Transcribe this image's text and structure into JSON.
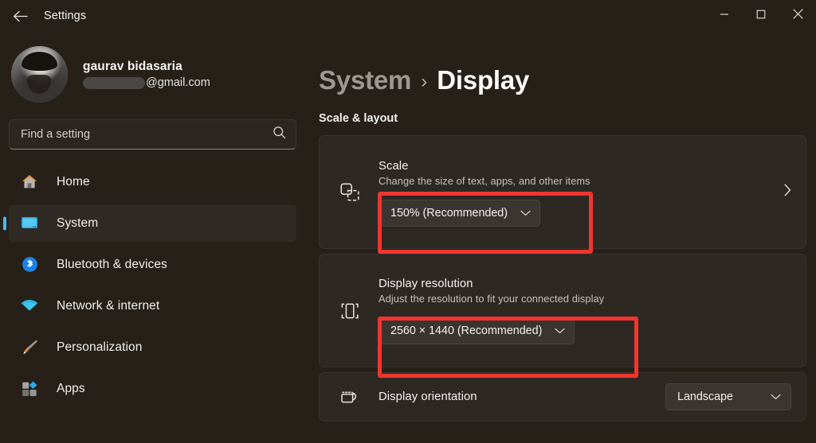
{
  "window": {
    "title": "Settings",
    "back_icon": "back-arrow-icon",
    "controls": {
      "minimize": "minimize-icon",
      "maximize": "maximize-icon",
      "close": "close-icon"
    }
  },
  "account": {
    "name": "gaurav bidasaria",
    "email_domain": "@gmail.com",
    "email_redacted": true,
    "avatar": "user-avatar"
  },
  "search": {
    "placeholder": "Find a setting",
    "value": "",
    "icon": "search-icon"
  },
  "sidebar": {
    "items": [
      {
        "label": "Home",
        "icon": "home-icon",
        "selected": false
      },
      {
        "label": "System",
        "icon": "monitor-icon",
        "selected": true
      },
      {
        "label": "Bluetooth & devices",
        "icon": "bluetooth-icon",
        "selected": false
      },
      {
        "label": "Network & internet",
        "icon": "wifi-icon",
        "selected": false
      },
      {
        "label": "Personalization",
        "icon": "paintbrush-icon",
        "selected": false
      },
      {
        "label": "Apps",
        "icon": "apps-icon",
        "selected": false
      }
    ]
  },
  "main": {
    "breadcrumb": {
      "parent": "System",
      "separator": "›",
      "current": "Display"
    },
    "section_title": "Scale & layout",
    "cards": [
      {
        "id": "scale",
        "icon": "scale-icon",
        "title": "Scale",
        "subtitle": "Change the size of text, apps, and other items",
        "dropdown_value": "150% (Recommended)",
        "has_chevron": true,
        "chevron_icon": "chevron-right-icon",
        "highlighted": true
      },
      {
        "id": "resolution",
        "icon": "resolution-icon",
        "title": "Display resolution",
        "subtitle": "Adjust the resolution to fit your connected display",
        "dropdown_value": "2560 × 1440 (Recommended)",
        "has_chevron": false,
        "highlighted": true
      },
      {
        "id": "orientation",
        "icon": "rotate-display-icon",
        "title": "Display orientation",
        "subtitle": "",
        "dropdown_value": "Landscape",
        "has_chevron": false,
        "highlighted": false
      }
    ]
  },
  "annotations": {
    "color": "#f2352f",
    "boxes": [
      {
        "target": "scale-dropdown"
      },
      {
        "target": "resolution-dropdown"
      }
    ]
  },
  "colors": {
    "window_bg": "#262019",
    "card_bg": "#2e2823",
    "dropdown_bg": "#3b3530",
    "accent": "#4cb8ef",
    "annotation_red": "#f2352f"
  }
}
